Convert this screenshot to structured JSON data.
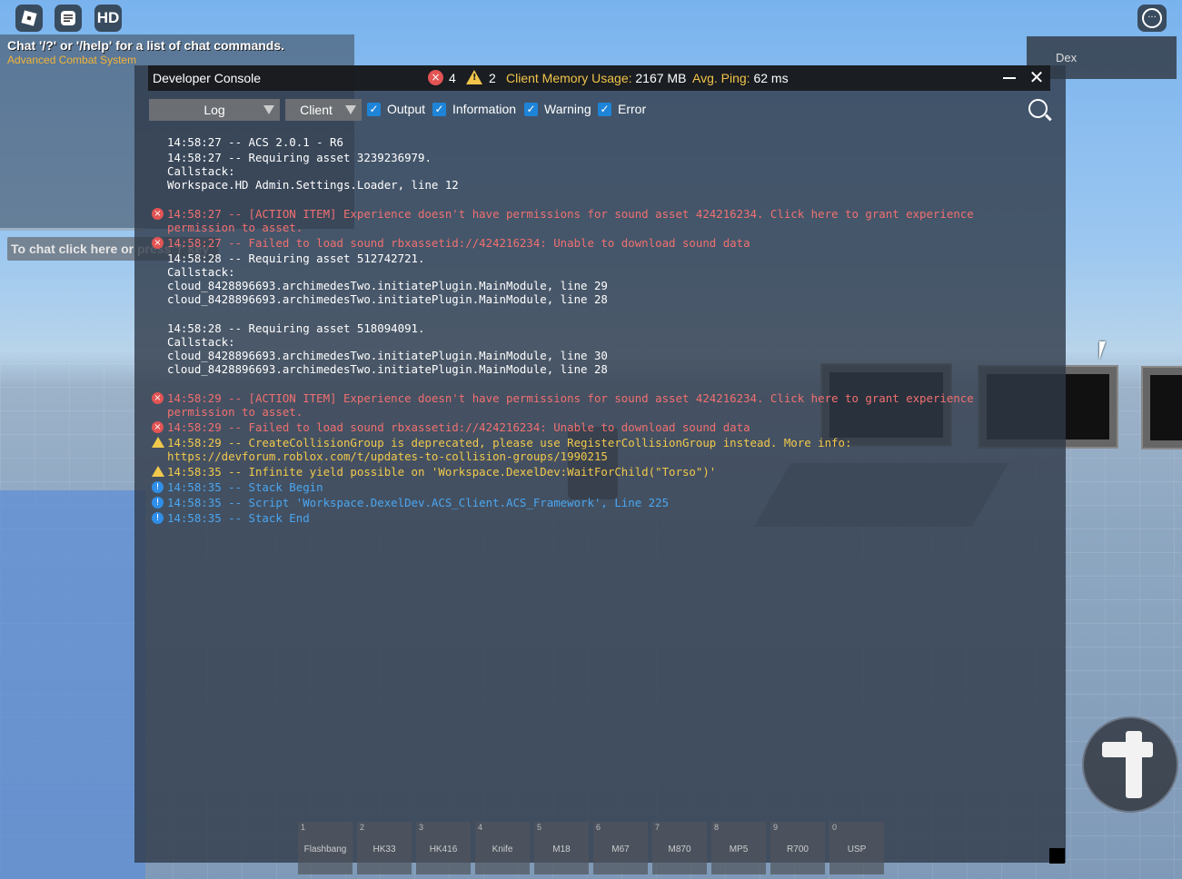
{
  "topbar": {
    "roblox_icon": "roblox-logo-icon",
    "chat_icon": "chat-icon",
    "hd_label": "HD",
    "menu_icon": "more-options-icon"
  },
  "chat": {
    "help_line": "Chat '/?' or '/help' for a list of chat commands.",
    "system_line": "Advanced Combat System",
    "input_placeholder": "To chat click here or press '/' key"
  },
  "dex": {
    "label": "Dex"
  },
  "console": {
    "title": "Developer Console",
    "error_count": "4",
    "warning_count": "2",
    "memory_label": "Client Memory Usage:",
    "memory_value": "2167 MB",
    "ping_label": "Avg. Ping:",
    "ping_value": "62 ms",
    "log_dropdown": "Log",
    "client_dropdown": "Client",
    "filters": {
      "output": "Output",
      "information": "Information",
      "warning": "Warning",
      "error": "Error"
    },
    "log_lines": [
      {
        "level": "output",
        "text": "14:58:27 -- ACS 2.0.1 - R6"
      },
      {
        "level": "output",
        "text": "14:58:27 -- Requiring asset 3239236979."
      },
      {
        "level": "output",
        "text": "Callstack:"
      },
      {
        "level": "output",
        "text": "Workspace.HD Admin.Settings.Loader, line 12"
      },
      {
        "level": "error",
        "text": "14:58:27 -- [ACTION ITEM] Experience doesn't have permissions for sound asset 424216234. Click here to grant experience"
      },
      {
        "level": "error-cont",
        "text": "permission to asset."
      },
      {
        "level": "error",
        "text": "14:58:27 -- Failed to load sound rbxassetid://424216234: Unable to download sound data"
      },
      {
        "level": "output",
        "text": "14:58:28 -- Requiring asset 512742721."
      },
      {
        "level": "output",
        "text": "Callstack:"
      },
      {
        "level": "output",
        "text": "cloud_8428896693.archimedesTwo.initiatePlugin.MainModule, line 29"
      },
      {
        "level": "output",
        "text": "cloud_8428896693.archimedesTwo.initiatePlugin.MainModule, line 28"
      },
      {
        "level": "output",
        "text": "14:58:28 -- Requiring asset 518094091."
      },
      {
        "level": "output",
        "text": "Callstack:"
      },
      {
        "level": "output",
        "text": "cloud_8428896693.archimedesTwo.initiatePlugin.MainModule, line 30"
      },
      {
        "level": "output",
        "text": "cloud_8428896693.archimedesTwo.initiatePlugin.MainModule, line 28"
      },
      {
        "level": "error",
        "text": "14:58:29 -- [ACTION ITEM] Experience doesn't have permissions for sound asset 424216234. Click here to grant experience"
      },
      {
        "level": "error-cont",
        "text": "permission to asset."
      },
      {
        "level": "error",
        "text": "14:58:29 -- Failed to load sound rbxassetid://424216234: Unable to download sound data"
      },
      {
        "level": "warning",
        "text": "14:58:29 -- CreateCollisionGroup is deprecated, please use RegisterCollisionGroup instead. More info:"
      },
      {
        "level": "warning-cont",
        "text": "https://devforum.roblox.com/t/updates-to-collision-groups/1990215"
      },
      {
        "level": "warning",
        "text": "14:58:35 -- Infinite yield possible on 'Workspace.DexelDev:WaitForChild(\"Torso\")'"
      },
      {
        "level": "info",
        "text": "14:58:35 -- Stack Begin"
      },
      {
        "level": "info",
        "text": "14:58:35 -- Script 'Workspace.DexelDev.ACS_Client.ACS_Framework', Line 225"
      },
      {
        "level": "info",
        "text": "14:58:35 -- Stack End"
      }
    ]
  },
  "hotbar": [
    {
      "num": "1",
      "name": "Flashbang"
    },
    {
      "num": "2",
      "name": "HK33"
    },
    {
      "num": "3",
      "name": "HK416"
    },
    {
      "num": "4",
      "name": "Knife"
    },
    {
      "num": "5",
      "name": "M18"
    },
    {
      "num": "6",
      "name": "M67"
    },
    {
      "num": "7",
      "name": "M870"
    },
    {
      "num": "8",
      "name": "MP5"
    },
    {
      "num": "9",
      "name": "R700"
    },
    {
      "num": "0",
      "name": "USP"
    }
  ],
  "colors": {
    "error": "#f07070",
    "warning": "#f2c94c",
    "info": "#4aa6f2",
    "accent": "#1e84d8"
  }
}
